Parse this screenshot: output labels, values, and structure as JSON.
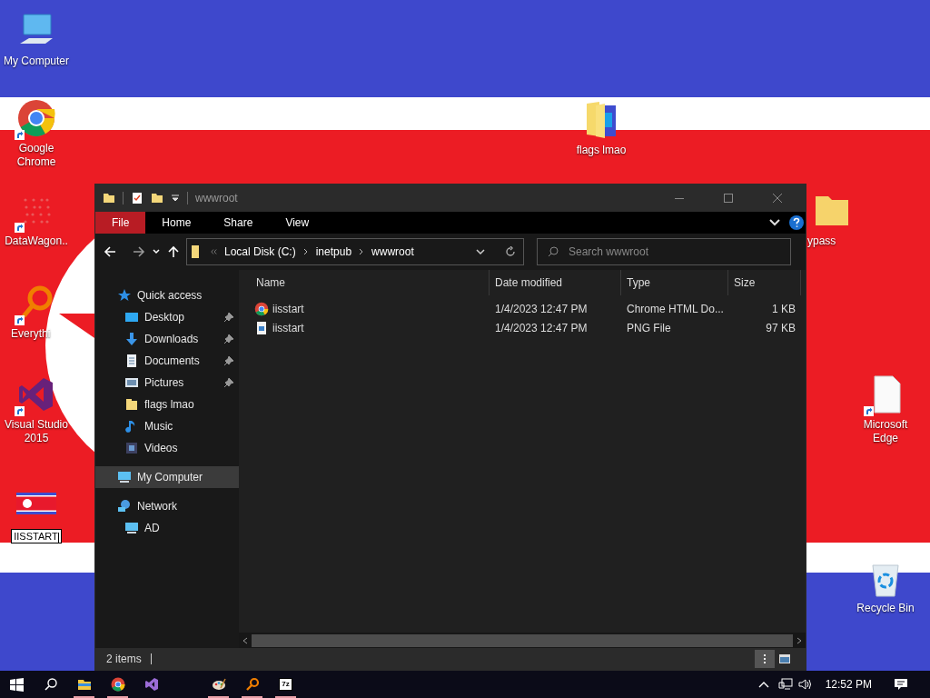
{
  "desktop": {
    "icons": [
      {
        "label": "My Computer",
        "kind": "computer",
        "shortcut": false
      },
      {
        "label": "Google Chrome",
        "kind": "chrome",
        "shortcut": true
      },
      {
        "label": "DataWagon..",
        "kind": "dots",
        "shortcut": true
      },
      {
        "label": "Everythi",
        "kind": "magnifier",
        "shortcut": true
      },
      {
        "label": "Visual Studio 2015",
        "kind": "vs",
        "shortcut": true
      },
      {
        "label": "IISSTART",
        "kind": "flag",
        "shortcut": false,
        "renaming": true
      },
      {
        "label": "flags lmao",
        "kind": "folder-flag",
        "shortcut": false
      },
      {
        "label": "ypass",
        "kind": "folder",
        "shortcut": false
      },
      {
        "label": "Microsoft Edge",
        "kind": "file",
        "shortcut": true
      },
      {
        "label": "Recycle Bin",
        "kind": "bin",
        "shortcut": false
      }
    ]
  },
  "explorer": {
    "title": "wwwroot",
    "ribbon_tabs": [
      {
        "label": "File",
        "selected": true
      },
      {
        "label": "Home",
        "selected": false
      },
      {
        "label": "Share",
        "selected": false
      },
      {
        "label": "View",
        "selected": false
      }
    ],
    "breadcrumb": [
      "Local Disk (C:)",
      "inetpub",
      "wwwroot"
    ],
    "search": {
      "placeholder": "Search wwwroot"
    },
    "nav": [
      {
        "label": "Quick access",
        "kind": "star",
        "selected": false,
        "children": [
          {
            "label": "Desktop",
            "kind": "desktop",
            "pinned": true,
            "selected": false
          },
          {
            "label": "Downloads",
            "kind": "download",
            "pinned": true,
            "selected": false
          },
          {
            "label": "Documents",
            "kind": "document",
            "pinned": true,
            "selected": false
          },
          {
            "label": "Pictures",
            "kind": "pictures",
            "pinned": true,
            "selected": false
          },
          {
            "label": "flags lmao",
            "kind": "folder",
            "pinned": false,
            "selected": false
          },
          {
            "label": "Music",
            "kind": "music",
            "pinned": false,
            "selected": false
          },
          {
            "label": "Videos",
            "kind": "videos",
            "pinned": false,
            "selected": false
          }
        ]
      },
      {
        "label": "My Computer",
        "kind": "computer",
        "selected": true
      },
      {
        "label": "Network",
        "kind": "network",
        "selected": false,
        "children": [
          {
            "label": "AD",
            "kind": "computer",
            "pinned": false,
            "selected": false
          }
        ]
      }
    ],
    "columns": [
      "Name",
      "Date modified",
      "Type",
      "Size"
    ],
    "rows": [
      {
        "name": "iisstart",
        "kind": "chrome",
        "date": "1/4/2023 12:47 PM",
        "type": "Chrome HTML Do...",
        "size": "1 KB",
        "selected": false
      },
      {
        "name": "iisstart",
        "kind": "image",
        "date": "1/4/2023 12:47 PM",
        "type": "PNG File",
        "size": "97 KB",
        "selected": false
      }
    ],
    "status": "2 items",
    "views": [
      {
        "kind": "details",
        "selected": true
      },
      {
        "kind": "large-icons",
        "selected": false
      }
    ]
  },
  "taskbar": {
    "pinned": [
      {
        "kind": "explorer",
        "running": true
      },
      {
        "kind": "chrome",
        "running": true
      },
      {
        "kind": "vs",
        "running": false
      }
    ],
    "apps": [
      {
        "kind": "paint",
        "running": true
      },
      {
        "kind": "magnifier",
        "running": true
      },
      {
        "kind": "sevenzip",
        "running": true
      }
    ],
    "sevenzip_label": "7z",
    "clock": "12:52 PM"
  }
}
